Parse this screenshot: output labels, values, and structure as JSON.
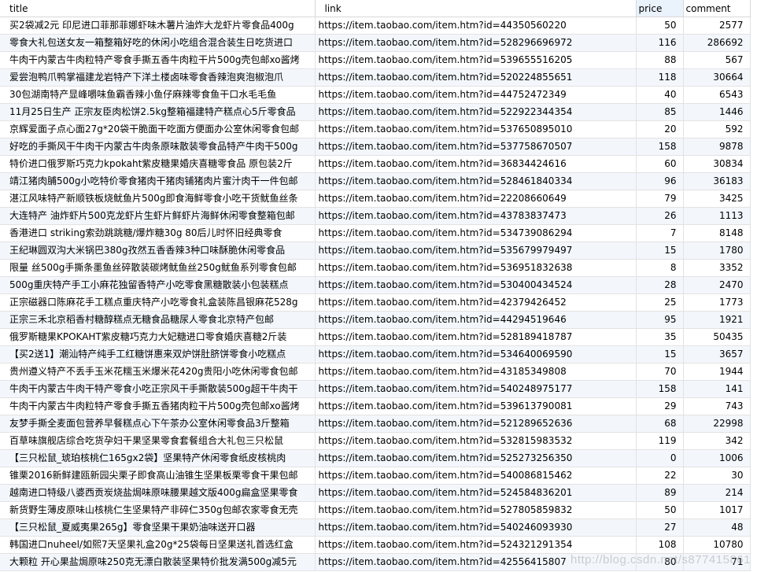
{
  "columns": {
    "title": "title",
    "link": "link",
    "price": "price",
    "comment": "comment"
  },
  "rows": [
    {
      "title": "买2袋减2元 印尼进口菲那菲娜虾味木薯片油炸大龙虾片零食品400g",
      "link": "https://item.taobao.com/item.htm?id=44350560220",
      "price": "50",
      "comment": "2577"
    },
    {
      "title": "零食大礼包送女友一箱整箱好吃的休闲小吃组合混合装生日吃货进口",
      "link": "https://item.taobao.com/item.htm?id=528296696972",
      "price": "116",
      "comment": "286692"
    },
    {
      "title": "牛肉干内蒙古牛肉粒特产零食手撕五香牛肉粒干片500g壳包邮xo酱烤",
      "link": "https://item.taobao.com/item.htm?id=539655516205",
      "price": "88",
      "comment": "567"
    },
    {
      "title": "爱尝泡鸭爪鸭掌福建龙岩特产下洋土楼卤味零食香辣泡爽泡椒泡爪",
      "link": "https://item.taobao.com/item.htm?id=520224855651",
      "price": "118",
      "comment": "30664"
    },
    {
      "title": "30包湖南特产显峰嚼味鱼霸香辣小鱼仔麻辣零食鱼干口水毛毛鱼",
      "link": "https://item.taobao.com/item.htm?id=44752472349",
      "price": "40",
      "comment": "6543"
    },
    {
      "title": "11月25日生产 正宗友臣肉松饼2.5kg整箱福建特产糕点心5斤零食品",
      "link": "https://item.taobao.com/item.htm?id=522922344354",
      "price": "85",
      "comment": "1446"
    },
    {
      "title": "京辉爱面子点心面27g*20袋干脆面干吃面方便面办公室休闲零食包邮",
      "link": "https://item.taobao.com/item.htm?id=537650895010",
      "price": "20",
      "comment": "592"
    },
    {
      "title": "好吃的手撕风干牛肉干内蒙古牛肉条原味散装零食品特产牛肉干500g",
      "link": "https://item.taobao.com/item.htm?id=537758670507",
      "price": "158",
      "comment": "9878"
    },
    {
      "title": "特价进口俄罗斯巧克力kpokaht紫皮糖果婚庆喜糖零食品 原包装2斤",
      "link": "https://item.taobao.com/item.htm?id=36834424616",
      "price": "60",
      "comment": "30834"
    },
    {
      "title": "靖江猪肉脯500g小吃特价零食猪肉干猪肉铺猪肉片蜜汁肉干一件包邮",
      "link": "https://item.taobao.com/item.htm?id=528461840334",
      "price": "96",
      "comment": "36183"
    },
    {
      "title": "湛江风味特产新顺铁板烧鱿鱼片500g即食海鲜零食小吃干货鱿鱼丝条",
      "link": "https://item.taobao.com/item.htm?id=22208660649",
      "price": "79",
      "comment": "3425"
    },
    {
      "title": "大连特产 油炸虾片500克龙虾片生虾片鲜虾片海鲜休闲零食整箱包邮",
      "link": "https://item.taobao.com/item.htm?id=43783837473",
      "price": "26",
      "comment": "1113"
    },
    {
      "title": "香港进口 striking索劲跳跳糖/爆炸糖30g 80后儿时怀旧经典零食",
      "link": "https://item.taobao.com/item.htm?id=534739086294",
      "price": "7",
      "comment": "8148"
    },
    {
      "title": "王纪琳圆双沟大米锅巴380g孜然五香香辣3种口味酥脆休闲零食品",
      "link": "https://item.taobao.com/item.htm?id=535679979497",
      "price": "15",
      "comment": "1780"
    },
    {
      "title": "限量 丝500g手撕条墨鱼丝碎散装碳烤鱿鱼丝250g鱿鱼系列零食包邮",
      "link": "https://item.taobao.com/item.htm?id=536951832638",
      "price": "8",
      "comment": "3352"
    },
    {
      "title": "500g重庆特产手工小麻花独留香特产小吃零食黑糖散装小包装糕点",
      "link": "https://item.taobao.com/item.htm?id=530400434524",
      "price": "28",
      "comment": "2470"
    },
    {
      "title": "正宗磁器口陈麻花手工糕点重庆特产小吃零食礼盒装陈昌银麻花528g",
      "link": "https://item.taobao.com/item.htm?id=42379426452",
      "price": "25",
      "comment": "1773"
    },
    {
      "title": "正宗三禾北京稻香村糖醇糕点无糖食品糖尿人零食北京特产包邮",
      "link": "https://item.taobao.com/item.htm?id=44294519646",
      "price": "95",
      "comment": "1921"
    },
    {
      "title": "俄罗斯糖果KPOKAHT紫皮糖巧克力大妃糖进口零食婚庆喜糖2斤装",
      "link": "https://item.taobao.com/item.htm?id=528189418787",
      "price": "35",
      "comment": "50435"
    },
    {
      "title": "【买2送1】潮汕特产纯手工红糖饼惠来双炉饼肚脐饼零食小吃糕点",
      "link": "https://item.taobao.com/item.htm?id=534640069590",
      "price": "15",
      "comment": "3657"
    },
    {
      "title": "贵州遵义特产不丢手玉米花糯玉米爆米花420g贵阳小吃休闲零食包邮",
      "link": "https://item.taobao.com/item.htm?id=43185349808",
      "price": "70",
      "comment": "1944"
    },
    {
      "title": "牛肉干内蒙古牛肉干特产零食小吃正宗风干手撕散装500g超干牛肉干",
      "link": "https://item.taobao.com/item.htm?id=540248975177",
      "price": "158",
      "comment": "141"
    },
    {
      "title": "牛肉干内蒙古牛肉粒特产零食手撕五香猪肉粒干片500g壳包邮xo酱烤",
      "link": "https://item.taobao.com/item.htm?id=539613790081",
      "price": "29",
      "comment": "743"
    },
    {
      "title": "友梦手撕全麦面包营养早餐糕点心下午茶办公室休闲零食品3斤整箱",
      "link": "https://item.taobao.com/item.htm?id=521289652636",
      "price": "68",
      "comment": "22998"
    },
    {
      "title": "百草味旗舰店综合吃货孕妇干果坚果零食套餐组合大礼包三只松鼠",
      "link": "https://item.taobao.com/item.htm?id=532815983532",
      "price": "119",
      "comment": "342"
    },
    {
      "title": "【三只松鼠_琥珀核桃仁165gx2袋】坚果特产休闲零食纸皮核桃肉",
      "link": "https://item.taobao.com/item.htm?id=525273256350",
      "price": "0",
      "comment": "1006"
    },
    {
      "title": "锥栗2016新鲜建瓯新园尖栗子即食高山油锥生坚果板栗零食干果包邮",
      "link": "https://item.taobao.com/item.htm?id=540086815462",
      "price": "22",
      "comment": "30"
    },
    {
      "title": "越南进口特级八婆西贡炭烧盐焗味原味腰果越文版400g扁盒坚果零食",
      "link": "https://item.taobao.com/item.htm?id=524584836201",
      "price": "89",
      "comment": "214"
    },
    {
      "title": "新货野生薄皮原味山核桃仁生坚果特产非碎仁350g包邮农家零食无壳",
      "link": "https://item.taobao.com/item.htm?id=527805859832",
      "price": "50",
      "comment": "1017"
    },
    {
      "title": "【三只松鼠_夏威夷果265g】零食坚果干果奶油味送开口器",
      "link": "https://item.taobao.com/item.htm?id=540246093930",
      "price": "27",
      "comment": "48"
    },
    {
      "title": "韩国进口nuheel/如熙7天坚果礼盒20g*25袋每日坚果送礼首选红盒",
      "link": "https://item.taobao.com/item.htm?id=524321291354",
      "price": "108",
      "comment": "10780"
    },
    {
      "title": "大颗粒 开心果盐焗原味250克无漂白散装坚果特价批发满500g减5元",
      "link": "https://item.taobao.com/item.htm?id=42556415807",
      "price": "80",
      "comment": "71"
    }
  ],
  "watermark": "http://blog.csdn.net/s877415861"
}
